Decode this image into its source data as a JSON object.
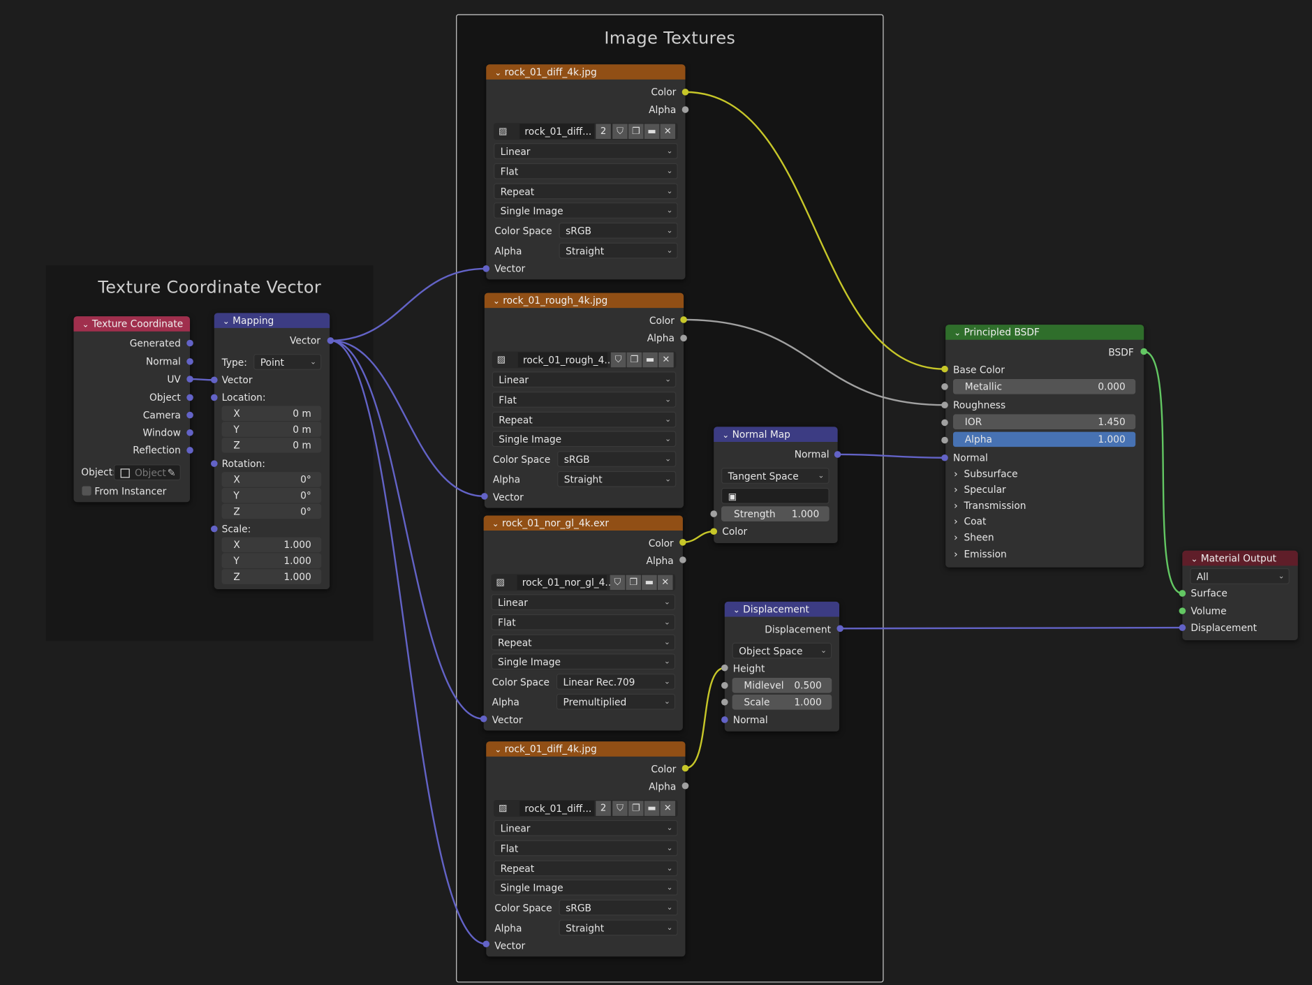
{
  "frames": {
    "texture_coordinate_vector": "Texture Coordinate Vector",
    "image_textures": "Image Textures"
  },
  "texture_coordinate": {
    "title": "Texture Coordinate",
    "outputs": [
      "Generated",
      "Normal",
      "UV",
      "Object",
      "Camera",
      "Window",
      "Reflection"
    ],
    "object_label": "Object:",
    "object_placeholder": "Object",
    "from_instancer": "From Instancer"
  },
  "mapping": {
    "title": "Mapping",
    "output": "Vector",
    "type_label": "Type:",
    "type_value": "Point",
    "vector_input": "Vector",
    "location_label": "Location:",
    "location": [
      {
        "axis": "X",
        "value": "0 m"
      },
      {
        "axis": "Y",
        "value": "0 m"
      },
      {
        "axis": "Z",
        "value": "0 m"
      }
    ],
    "rotation_label": "Rotation:",
    "rotation": [
      {
        "axis": "X",
        "value": "0°"
      },
      {
        "axis": "Y",
        "value": "0°"
      },
      {
        "axis": "Z",
        "value": "0°"
      }
    ],
    "scale_label": "Scale:",
    "scale": [
      {
        "axis": "X",
        "value": "1.000"
      },
      {
        "axis": "Y",
        "value": "1.000"
      },
      {
        "axis": "Z",
        "value": "1.000"
      }
    ]
  },
  "image_nodes": [
    {
      "title": "rock_01_diff_4k.jpg",
      "image_name": "rock_01_diff...",
      "users": "2",
      "interpolation": "Linear",
      "projection": "Flat",
      "extension": "Repeat",
      "source": "Single Image",
      "color_space": "sRGB",
      "alpha": "Straight",
      "out_color": "Color",
      "out_alpha": "Alpha",
      "in_vector": "Vector",
      "color_space_label": "Color Space",
      "alpha_label": "Alpha"
    },
    {
      "title": "rock_01_rough_4k.jpg",
      "image_name": "rock_01_rough_4...",
      "users": "",
      "interpolation": "Linear",
      "projection": "Flat",
      "extension": "Repeat",
      "source": "Single Image",
      "color_space": "sRGB",
      "alpha": "Straight",
      "out_color": "Color",
      "out_alpha": "Alpha",
      "in_vector": "Vector",
      "color_space_label": "Color Space",
      "alpha_label": "Alpha"
    },
    {
      "title": "rock_01_nor_gl_4k.exr",
      "image_name": "rock_01_nor_gl_4...",
      "users": "",
      "interpolation": "Linear",
      "projection": "Flat",
      "extension": "Repeat",
      "source": "Single Image",
      "color_space": "Linear Rec.709",
      "alpha": "Premultiplied",
      "out_color": "Color",
      "out_alpha": "Alpha",
      "in_vector": "Vector",
      "color_space_label": "Color Space",
      "alpha_label": "Alpha"
    },
    {
      "title": "rock_01_diff_4k.jpg",
      "image_name": "rock_01_diff...",
      "users": "2",
      "interpolation": "Linear",
      "projection": "Flat",
      "extension": "Repeat",
      "source": "Single Image",
      "color_space": "sRGB",
      "alpha": "Straight",
      "out_color": "Color",
      "out_alpha": "Alpha",
      "in_vector": "Vector",
      "color_space_label": "Color Space",
      "alpha_label": "Alpha"
    }
  ],
  "normal_map": {
    "title": "Normal Map",
    "output": "Normal",
    "space": "Tangent Space",
    "strength_label": "Strength",
    "strength_value": "1.000",
    "color_input": "Color"
  },
  "displacement": {
    "title": "Displacement",
    "output": "Displacement",
    "space": "Object Space",
    "height": "Height",
    "midlevel_label": "Midlevel",
    "midlevel_value": "0.500",
    "scale_label": "Scale",
    "scale_value": "1.000",
    "normal": "Normal"
  },
  "principled": {
    "title": "Principled BSDF",
    "output": "BSDF",
    "base_color": "Base Color",
    "metallic_label": "Metallic",
    "metallic_value": "0.000",
    "roughness": "Roughness",
    "ior_label": "IOR",
    "ior_value": "1.450",
    "alpha_label": "Alpha",
    "alpha_value": "1.000",
    "normal": "Normal",
    "panels": [
      "Subsurface",
      "Specular",
      "Transmission",
      "Coat",
      "Sheen",
      "Emission"
    ]
  },
  "material_output": {
    "title": "Material Output",
    "target": "All",
    "inputs": [
      "Surface",
      "Volume",
      "Displacement"
    ]
  },
  "colors": {
    "image_header": "#914f15",
    "vector_header": "#3c3c83",
    "input_header": "#a02f4d",
    "shader_header": "#2f6e2b",
    "output_header": "#5f1e29",
    "socket_color": "#c7c729",
    "socket_vector": "#6363c7",
    "socket_float": "#a1a1a1",
    "socket_shader": "#63c763",
    "highlight_field": "#4772b3"
  }
}
